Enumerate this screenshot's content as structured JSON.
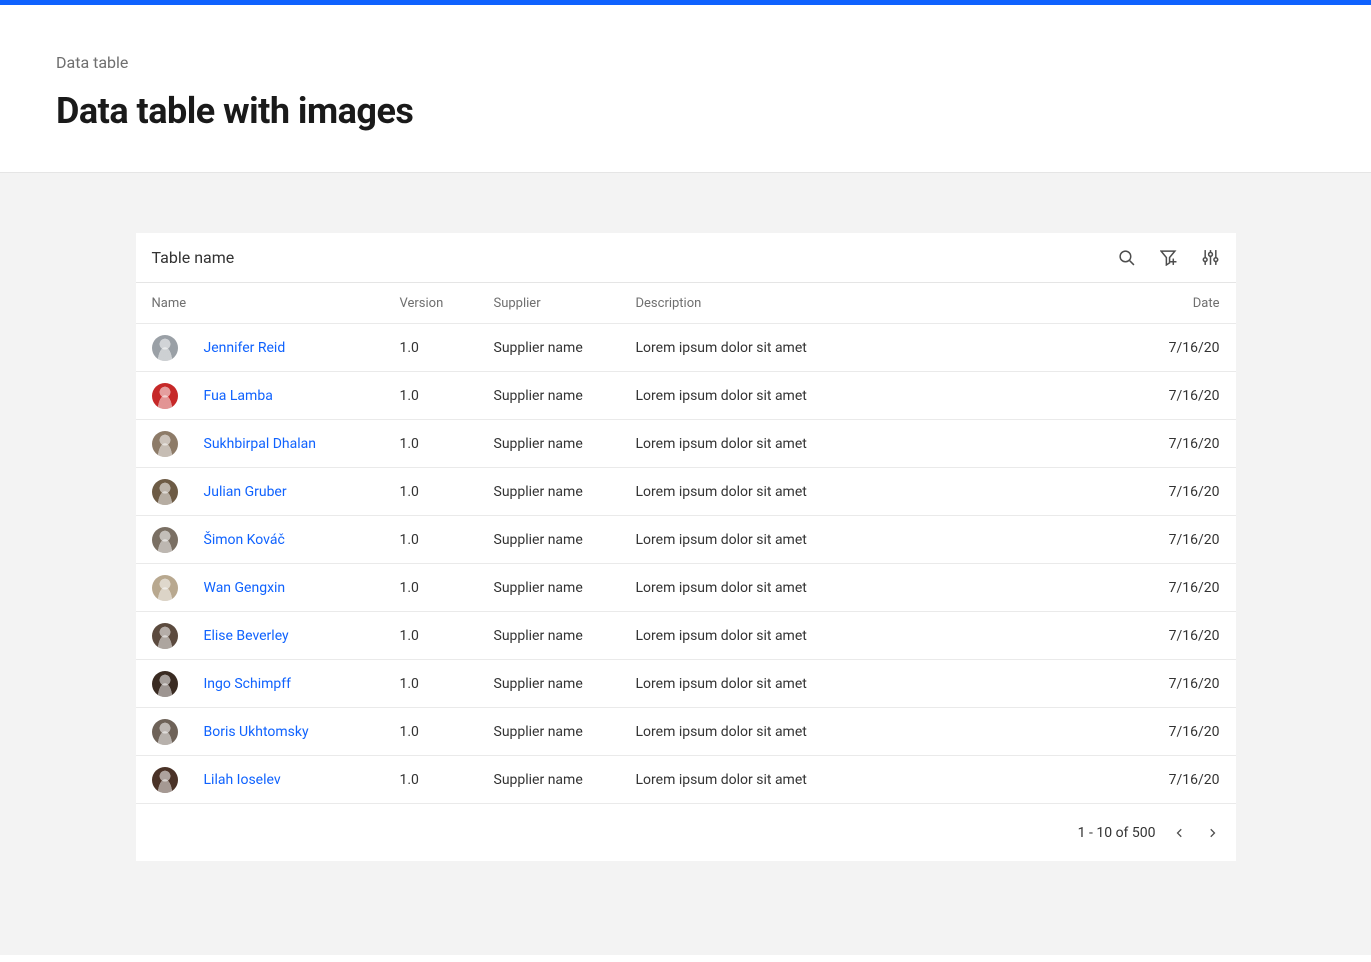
{
  "header": {
    "breadcrumb": "Data table",
    "title": "Data table with images"
  },
  "table": {
    "title": "Table name",
    "columns": {
      "name": "Name",
      "version": "Version",
      "supplier": "Supplier",
      "description": "Description",
      "date": "Date"
    },
    "rows": [
      {
        "name": "Jennifer Reid",
        "version": "1.0",
        "supplier": "Supplier name",
        "description": "Lorem ipsum dolor sit amet",
        "date": "7/16/20",
        "avatar": "#9aa0a6"
      },
      {
        "name": "Fua Lamba",
        "version": "1.0",
        "supplier": "Supplier name",
        "description": "Lorem ipsum dolor sit amet",
        "date": "7/16/20",
        "avatar": "#c62828"
      },
      {
        "name": "Sukhbirpal Dhalan",
        "version": "1.0",
        "supplier": "Supplier name",
        "description": "Lorem ipsum dolor sit amet",
        "date": "7/16/20",
        "avatar": "#8d7b68"
      },
      {
        "name": "Julian Gruber",
        "version": "1.0",
        "supplier": "Supplier name",
        "description": "Lorem ipsum dolor sit amet",
        "date": "7/16/20",
        "avatar": "#6d5b45"
      },
      {
        "name": "Šimon Kováč",
        "version": "1.0",
        "supplier": "Supplier name",
        "description": "Lorem ipsum dolor sit amet",
        "date": "7/16/20",
        "avatar": "#7a6f63"
      },
      {
        "name": "Wan Gengxin",
        "version": "1.0",
        "supplier": "Supplier name",
        "description": "Lorem ipsum dolor sit amet",
        "date": "7/16/20",
        "avatar": "#b8a88f"
      },
      {
        "name": "Elise Beverley",
        "version": "1.0",
        "supplier": "Supplier name",
        "description": "Lorem ipsum dolor sit amet",
        "date": "7/16/20",
        "avatar": "#5b4a3e"
      },
      {
        "name": "Ingo Schimpff",
        "version": "1.0",
        "supplier": "Supplier name",
        "description": "Lorem ipsum dolor sit amet",
        "date": "7/16/20",
        "avatar": "#3a2b22"
      },
      {
        "name": "Boris Ukhtomsky",
        "version": "1.0",
        "supplier": "Supplier name",
        "description": "Lorem ipsum dolor sit amet",
        "date": "7/16/20",
        "avatar": "#6e6258"
      },
      {
        "name": "Lilah Ioselev",
        "version": "1.0",
        "supplier": "Supplier name",
        "description": "Lorem ipsum dolor sit amet",
        "date": "7/16/20",
        "avatar": "#4a3227"
      }
    ],
    "pagination": "1 - 10 of 500"
  }
}
